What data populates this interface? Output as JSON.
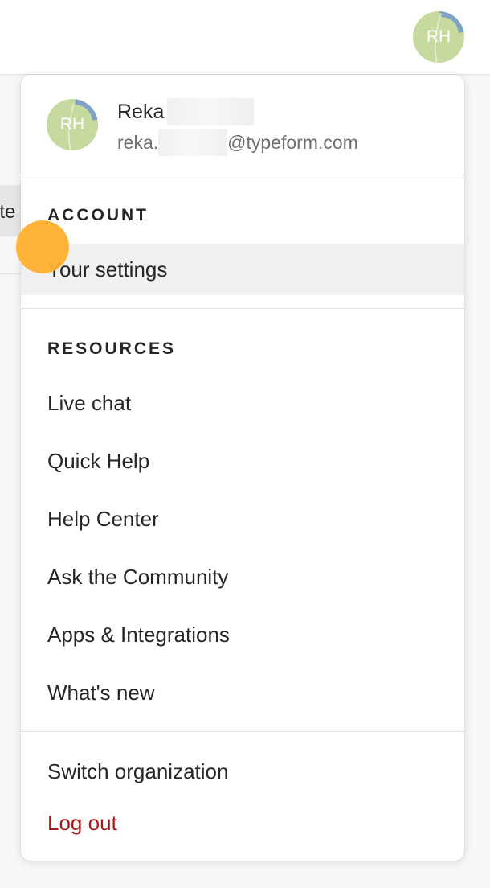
{
  "header": {
    "avatar_initials": "RH"
  },
  "background": {
    "partial_tab_text": "ate"
  },
  "menu": {
    "profile": {
      "avatar_initials": "RH",
      "name": "Reka",
      "email_prefix": "reka.",
      "email_domain": "@typeform.com"
    },
    "account": {
      "title": "ACCOUNT",
      "items": [
        {
          "label": "Your settings",
          "state": "hovered"
        }
      ]
    },
    "resources": {
      "title": "RESOURCES",
      "items": [
        {
          "label": "Live chat"
        },
        {
          "label": "Quick Help"
        },
        {
          "label": "Help Center"
        },
        {
          "label": "Ask the Community"
        },
        {
          "label": "Apps & Integrations"
        },
        {
          "label": "What's new"
        }
      ]
    },
    "footer": {
      "items": [
        {
          "label": "Switch organization"
        },
        {
          "label": "Log out",
          "color": "#a51b1b"
        }
      ]
    }
  },
  "colors": {
    "avatar_bg": "#c6d99e",
    "avatar_arc": "#7fa3c4",
    "hover_bg": "#f0f0f0",
    "logout": "#a51b1b",
    "cursor": "#ffb02e"
  }
}
